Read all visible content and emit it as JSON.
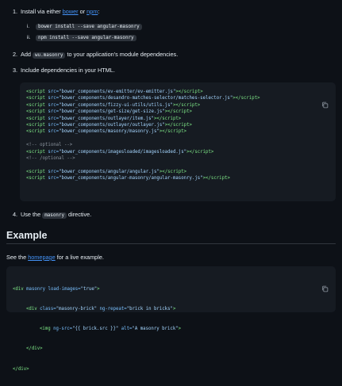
{
  "step1": {
    "num": "1.",
    "prefix": "Install via either ",
    "link1": "bower",
    "mid": " or ",
    "link2": "npm",
    "suffix": ":"
  },
  "substeps": [
    {
      "num": "i.",
      "code": "bower install --save angular-masonry"
    },
    {
      "num": "ii.",
      "code": "npm install --save angular-masonry"
    }
  ],
  "step2": {
    "num": "2.",
    "prefix": "Add ",
    "code": "wu.masonry",
    "suffix": " to your application's module dependencies."
  },
  "step3": {
    "num": "3.",
    "text": "Include dependencies in your HTML."
  },
  "code_block_1": {
    "scripts_a": [
      "bower_components/ev-emitter/ev-emitter.js",
      "bower_components/desandro-matches-selector/matches-selector.js",
      "bower_components/fizzy-ui-utils/utils.js",
      "bower_components/get-size/get-size.js",
      "bower_components/outlayer/item.js",
      "bower_components/outlayer/outlayer.js",
      "bower_components/masonry/masonry.js"
    ],
    "comment_open": "<!-- optional -->",
    "scripts_b": [
      "bower_components/imagesloaded/imagesloaded.js"
    ],
    "comment_close": "<!-- /optional -->",
    "scripts_c": [
      "bower_components/angular/angular.js",
      "bower_components/angular-masonry/angular-masonry.js"
    ]
  },
  "step4": {
    "num": "4.",
    "prefix": "Use the ",
    "code": "masonry",
    "suffix": " directive."
  },
  "section_title": "Example",
  "example_para": {
    "prefix": "See the ",
    "link": "homepage",
    "suffix": " for a live example."
  },
  "code_block_2": {
    "l1_tag": "<div",
    "l1_attr": " masonry load-images=",
    "l1_str": "\"true\"",
    "l1_end": ">",
    "l2_tag": "<div",
    "l2_attr1": " class=",
    "l2_str1": "\"masonry-brick\"",
    "l2_attr2": " ng-repeat=",
    "l2_str2": "\"brick in bricks\"",
    "l2_end": ">",
    "l3_tag": "<img",
    "l3_attr1": " ng-src=",
    "l3_str1": "\"{{ brick.src }}\"",
    "l3_attr2": " alt=",
    "l3_str2": "\"A masonry brick\"",
    "l3_end": ">",
    "l4": "</div>",
    "l5": "</div>"
  },
  "icons": {
    "copy": "copy-icon"
  }
}
